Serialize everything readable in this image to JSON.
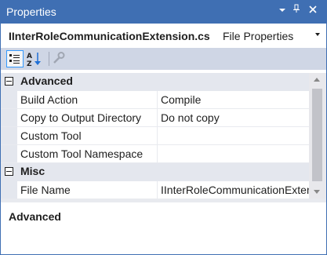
{
  "window": {
    "title": "Properties"
  },
  "title_buttons": [
    "chevron-down-icon",
    "pin-icon",
    "close-icon"
  ],
  "selector": {
    "object_name": "IInterRoleCommunicationExtension.cs",
    "object_type": "File Properties"
  },
  "toolbar": {
    "buttons": [
      "categorized-icon",
      "alphabetical-icon",
      "property-pages-icon"
    ]
  },
  "grid": {
    "categories": [
      {
        "name": "Advanced",
        "properties": [
          {
            "name": "Build Action",
            "value": "Compile"
          },
          {
            "name": "Copy to Output Directory",
            "value": "Do not copy"
          },
          {
            "name": "Custom Tool",
            "value": ""
          },
          {
            "name": "Custom Tool Namespace",
            "value": ""
          }
        ]
      },
      {
        "name": "Misc",
        "properties": [
          {
            "name": "File Name",
            "value": "IInterRoleCommunicationExtension.cs"
          }
        ]
      }
    ]
  },
  "description": {
    "title": "Advanced"
  },
  "colors": {
    "titlebar": "#3f6fb3",
    "toolbar": "#cfd6e5",
    "gutter": "#e4e7ee"
  }
}
